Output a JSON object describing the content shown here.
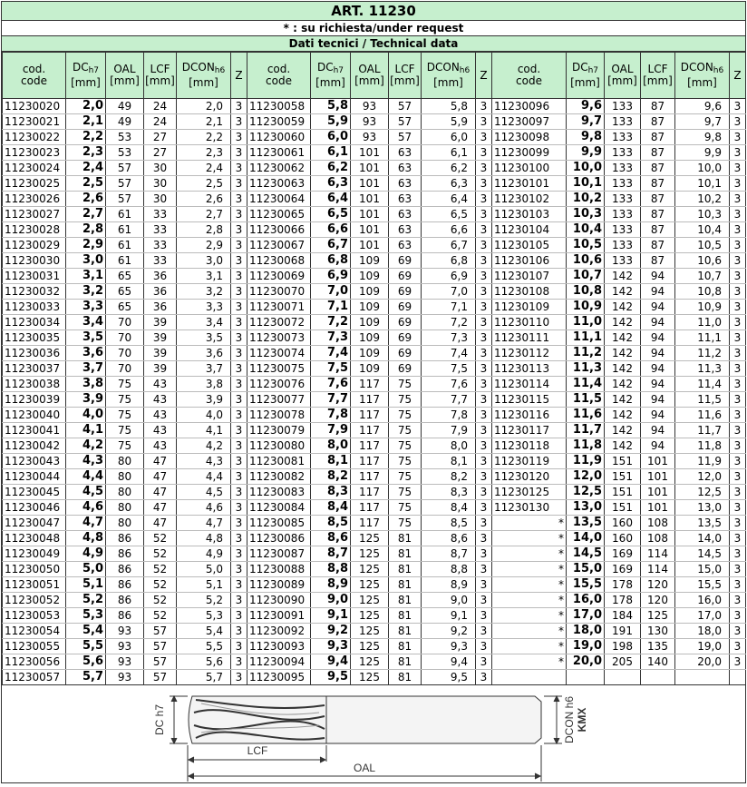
{
  "title": "ART. 11230",
  "subtitle": "* : su richiesta/under request",
  "section_title": "Dati tecnici / Technical data",
  "headers": {
    "code": "cod.\ncode",
    "dc": "DC",
    "dc_sub": "h7",
    "dc_unit": "[mm]",
    "oal": "OAL",
    "oal_unit": "[mm]",
    "lcf": "LCF",
    "lcf_unit": "[mm]",
    "dcon": "DCON",
    "dcon_sub": "h6",
    "dcon_unit": "[mm]",
    "z": "Z"
  },
  "blocks": [
    [
      [
        "11230020",
        "2,0",
        "49",
        "24",
        "2,0",
        "3"
      ],
      [
        "11230021",
        "2,1",
        "49",
        "24",
        "2,1",
        "3"
      ],
      [
        "11230022",
        "2,2",
        "53",
        "27",
        "2,2",
        "3"
      ],
      [
        "11230023",
        "2,3",
        "53",
        "27",
        "2,3",
        "3"
      ],
      [
        "11230024",
        "2,4",
        "57",
        "30",
        "2,4",
        "3"
      ],
      [
        "11230025",
        "2,5",
        "57",
        "30",
        "2,5",
        "3"
      ],
      [
        "11230026",
        "2,6",
        "57",
        "30",
        "2,6",
        "3"
      ],
      [
        "11230027",
        "2,7",
        "61",
        "33",
        "2,7",
        "3"
      ],
      [
        "11230028",
        "2,8",
        "61",
        "33",
        "2,8",
        "3"
      ],
      [
        "11230029",
        "2,9",
        "61",
        "33",
        "2,9",
        "3"
      ],
      [
        "11230030",
        "3,0",
        "61",
        "33",
        "3,0",
        "3"
      ],
      [
        "11230031",
        "3,1",
        "65",
        "36",
        "3,1",
        "3"
      ],
      [
        "11230032",
        "3,2",
        "65",
        "36",
        "3,2",
        "3"
      ],
      [
        "11230033",
        "3,3",
        "65",
        "36",
        "3,3",
        "3"
      ],
      [
        "11230034",
        "3,4",
        "70",
        "39",
        "3,4",
        "3"
      ],
      [
        "11230035",
        "3,5",
        "70",
        "39",
        "3,5",
        "3"
      ],
      [
        "11230036",
        "3,6",
        "70",
        "39",
        "3,6",
        "3"
      ],
      [
        "11230037",
        "3,7",
        "70",
        "39",
        "3,7",
        "3"
      ],
      [
        "11230038",
        "3,8",
        "75",
        "43",
        "3,8",
        "3"
      ],
      [
        "11230039",
        "3,9",
        "75",
        "43",
        "3,9",
        "3"
      ],
      [
        "11230040",
        "4,0",
        "75",
        "43",
        "4,0",
        "3"
      ],
      [
        "11230041",
        "4,1",
        "75",
        "43",
        "4,1",
        "3"
      ],
      [
        "11230042",
        "4,2",
        "75",
        "43",
        "4,2",
        "3"
      ],
      [
        "11230043",
        "4,3",
        "80",
        "47",
        "4,3",
        "3"
      ],
      [
        "11230044",
        "4,4",
        "80",
        "47",
        "4,4",
        "3"
      ],
      [
        "11230045",
        "4,5",
        "80",
        "47",
        "4,5",
        "3"
      ],
      [
        "11230046",
        "4,6",
        "80",
        "47",
        "4,6",
        "3"
      ],
      [
        "11230047",
        "4,7",
        "80",
        "47",
        "4,7",
        "3"
      ],
      [
        "11230048",
        "4,8",
        "86",
        "52",
        "4,8",
        "3"
      ],
      [
        "11230049",
        "4,9",
        "86",
        "52",
        "4,9",
        "3"
      ],
      [
        "11230050",
        "5,0",
        "86",
        "52",
        "5,0",
        "3"
      ],
      [
        "11230051",
        "5,1",
        "86",
        "52",
        "5,1",
        "3"
      ],
      [
        "11230052",
        "5,2",
        "86",
        "52",
        "5,2",
        "3"
      ],
      [
        "11230053",
        "5,3",
        "86",
        "52",
        "5,3",
        "3"
      ],
      [
        "11230054",
        "5,4",
        "93",
        "57",
        "5,4",
        "3"
      ],
      [
        "11230055",
        "5,5",
        "93",
        "57",
        "5,5",
        "3"
      ],
      [
        "11230056",
        "5,6",
        "93",
        "57",
        "5,6",
        "3"
      ],
      [
        "11230057",
        "5,7",
        "93",
        "57",
        "5,7",
        "3"
      ]
    ],
    [
      [
        "11230058",
        "5,8",
        "93",
        "57",
        "5,8",
        "3"
      ],
      [
        "11230059",
        "5,9",
        "93",
        "57",
        "5,9",
        "3"
      ],
      [
        "11230060",
        "6,0",
        "93",
        "57",
        "6,0",
        "3"
      ],
      [
        "11230061",
        "6,1",
        "101",
        "63",
        "6,1",
        "3"
      ],
      [
        "11230062",
        "6,2",
        "101",
        "63",
        "6,2",
        "3"
      ],
      [
        "11230063",
        "6,3",
        "101",
        "63",
        "6,3",
        "3"
      ],
      [
        "11230064",
        "6,4",
        "101",
        "63",
        "6,4",
        "3"
      ],
      [
        "11230065",
        "6,5",
        "101",
        "63",
        "6,5",
        "3"
      ],
      [
        "11230066",
        "6,6",
        "101",
        "63",
        "6,6",
        "3"
      ],
      [
        "11230067",
        "6,7",
        "101",
        "63",
        "6,7",
        "3"
      ],
      [
        "11230068",
        "6,8",
        "109",
        "69",
        "6,8",
        "3"
      ],
      [
        "11230069",
        "6,9",
        "109",
        "69",
        "6,9",
        "3"
      ],
      [
        "11230070",
        "7,0",
        "109",
        "69",
        "7,0",
        "3"
      ],
      [
        "11230071",
        "7,1",
        "109",
        "69",
        "7,1",
        "3"
      ],
      [
        "11230072",
        "7,2",
        "109",
        "69",
        "7,2",
        "3"
      ],
      [
        "11230073",
        "7,3",
        "109",
        "69",
        "7,3",
        "3"
      ],
      [
        "11230074",
        "7,4",
        "109",
        "69",
        "7,4",
        "3"
      ],
      [
        "11230075",
        "7,5",
        "109",
        "69",
        "7,5",
        "3"
      ],
      [
        "11230076",
        "7,6",
        "117",
        "75",
        "7,6",
        "3"
      ],
      [
        "11230077",
        "7,7",
        "117",
        "75",
        "7,7",
        "3"
      ],
      [
        "11230078",
        "7,8",
        "117",
        "75",
        "7,8",
        "3"
      ],
      [
        "11230079",
        "7,9",
        "117",
        "75",
        "7,9",
        "3"
      ],
      [
        "11230080",
        "8,0",
        "117",
        "75",
        "8,0",
        "3"
      ],
      [
        "11230081",
        "8,1",
        "117",
        "75",
        "8,1",
        "3"
      ],
      [
        "11230082",
        "8,2",
        "117",
        "75",
        "8,2",
        "3"
      ],
      [
        "11230083",
        "8,3",
        "117",
        "75",
        "8,3",
        "3"
      ],
      [
        "11230084",
        "8,4",
        "117",
        "75",
        "8,4",
        "3"
      ],
      [
        "11230085",
        "8,5",
        "117",
        "75",
        "8,5",
        "3"
      ],
      [
        "11230086",
        "8,6",
        "125",
        "81",
        "8,6",
        "3"
      ],
      [
        "11230087",
        "8,7",
        "125",
        "81",
        "8,7",
        "3"
      ],
      [
        "11230088",
        "8,8",
        "125",
        "81",
        "8,8",
        "3"
      ],
      [
        "11230089",
        "8,9",
        "125",
        "81",
        "8,9",
        "3"
      ],
      [
        "11230090",
        "9,0",
        "125",
        "81",
        "9,0",
        "3"
      ],
      [
        "11230091",
        "9,1",
        "125",
        "81",
        "9,1",
        "3"
      ],
      [
        "11230092",
        "9,2",
        "125",
        "81",
        "9,2",
        "3"
      ],
      [
        "11230093",
        "9,3",
        "125",
        "81",
        "9,3",
        "3"
      ],
      [
        "11230094",
        "9,4",
        "125",
        "81",
        "9,4",
        "3"
      ],
      [
        "11230095",
        "9,5",
        "125",
        "81",
        "9,5",
        "3"
      ]
    ],
    [
      [
        "11230096",
        "9,6",
        "133",
        "87",
        "9,6",
        "3"
      ],
      [
        "11230097",
        "9,7",
        "133",
        "87",
        "9,7",
        "3"
      ],
      [
        "11230098",
        "9,8",
        "133",
        "87",
        "9,8",
        "3"
      ],
      [
        "11230099",
        "9,9",
        "133",
        "87",
        "9,9",
        "3"
      ],
      [
        "11230100",
        "10,0",
        "133",
        "87",
        "10,0",
        "3"
      ],
      [
        "11230101",
        "10,1",
        "133",
        "87",
        "10,1",
        "3"
      ],
      [
        "11230102",
        "10,2",
        "133",
        "87",
        "10,2",
        "3"
      ],
      [
        "11230103",
        "10,3",
        "133",
        "87",
        "10,3",
        "3"
      ],
      [
        "11230104",
        "10,4",
        "133",
        "87",
        "10,4",
        "3"
      ],
      [
        "11230105",
        "10,5",
        "133",
        "87",
        "10,5",
        "3"
      ],
      [
        "11230106",
        "10,6",
        "133",
        "87",
        "10,6",
        "3"
      ],
      [
        "11230107",
        "10,7",
        "142",
        "94",
        "10,7",
        "3"
      ],
      [
        "11230108",
        "10,8",
        "142",
        "94",
        "10,8",
        "3"
      ],
      [
        "11230109",
        "10,9",
        "142",
        "94",
        "10,9",
        "3"
      ],
      [
        "11230110",
        "11,0",
        "142",
        "94",
        "11,0",
        "3"
      ],
      [
        "11230111",
        "11,1",
        "142",
        "94",
        "11,1",
        "3"
      ],
      [
        "11230112",
        "11,2",
        "142",
        "94",
        "11,2",
        "3"
      ],
      [
        "11230113",
        "11,3",
        "142",
        "94",
        "11,3",
        "3"
      ],
      [
        "11230114",
        "11,4",
        "142",
        "94",
        "11,4",
        "3"
      ],
      [
        "11230115",
        "11,5",
        "142",
        "94",
        "11,5",
        "3"
      ],
      [
        "11230116",
        "11,6",
        "142",
        "94",
        "11,6",
        "3"
      ],
      [
        "11230117",
        "11,7",
        "142",
        "94",
        "11,7",
        "3"
      ],
      [
        "11230118",
        "11,8",
        "142",
        "94",
        "11,8",
        "3"
      ],
      [
        "11230119",
        "11,9",
        "151",
        "101",
        "11,9",
        "3"
      ],
      [
        "11230120",
        "12,0",
        "151",
        "101",
        "12,0",
        "3"
      ],
      [
        "11230125",
        "12,5",
        "151",
        "101",
        "12,5",
        "3"
      ],
      [
        "11230130",
        "13,0",
        "151",
        "101",
        "13,0",
        "3"
      ],
      [
        "*",
        "13,5",
        "160",
        "108",
        "13,5",
        "3"
      ],
      [
        "*",
        "14,0",
        "160",
        "108",
        "14,0",
        "3"
      ],
      [
        "*",
        "14,5",
        "169",
        "114",
        "14,5",
        "3"
      ],
      [
        "*",
        "15,0",
        "169",
        "114",
        "15,0",
        "3"
      ],
      [
        "*",
        "15,5",
        "178",
        "120",
        "15,5",
        "3"
      ],
      [
        "*",
        "16,0",
        "178",
        "120",
        "16,0",
        "3"
      ],
      [
        "*",
        "17,0",
        "184",
        "125",
        "17,0",
        "3"
      ],
      [
        "*",
        "18,0",
        "191",
        "130",
        "18,0",
        "3"
      ],
      [
        "*",
        "19,0",
        "198",
        "135",
        "19,0",
        "3"
      ],
      [
        "*",
        "20,0",
        "205",
        "140",
        "20,0",
        "3"
      ],
      [
        "",
        "",
        "",
        "",
        "",
        ""
      ]
    ]
  ],
  "drawing": {
    "label_dc": "DC h7",
    "label_dcon": "DCON h6",
    "label_kmx": "KMX",
    "label_lcf": "LCF",
    "label_oal": "OAL",
    "line_color": "#333333"
  }
}
